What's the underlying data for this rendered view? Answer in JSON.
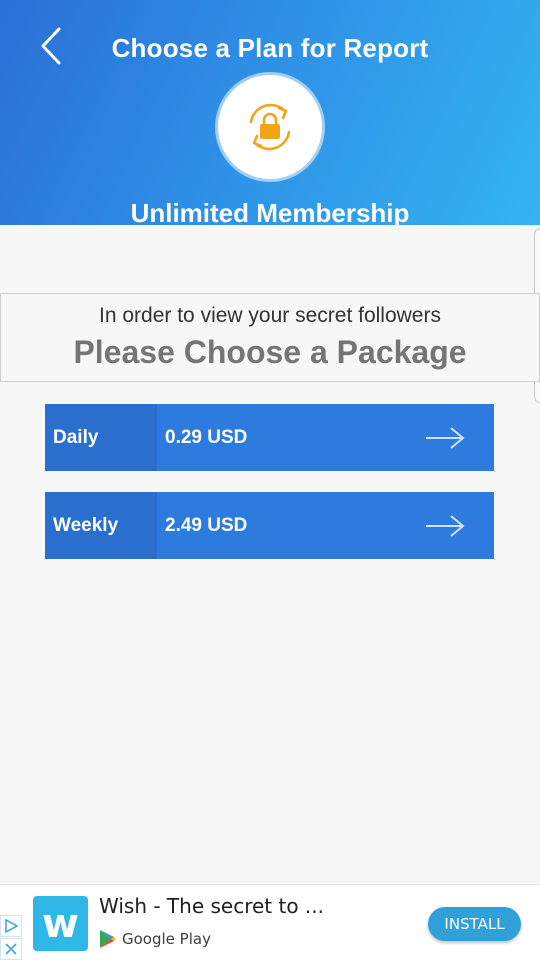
{
  "header": {
    "title": "Choose a Plan for Report",
    "membership_label": "Unlimited Membership",
    "icons": {
      "back": "chevron-left-icon",
      "lock": "lock-refresh-icon"
    }
  },
  "info": {
    "subtitle": "In order to view your secret followers",
    "heading": "Please Choose a Package"
  },
  "plans": [
    {
      "name": "Daily",
      "price": "0.29 USD"
    },
    {
      "name": "Weekly",
      "price": "2.49 USD"
    }
  ],
  "ad": {
    "title": "Wish - The secret to ...",
    "store": "Google Play",
    "install_label": "INSTALL",
    "logo_letter": "w"
  },
  "colors": {
    "header_start": "#2b6fd6",
    "header_end": "#34b4f0",
    "plan_bg": "#2e7be0",
    "plan_name_bg": "#2a6fce",
    "lock_orange": "#f2a51a",
    "install_bg": "#2fa0d8"
  }
}
